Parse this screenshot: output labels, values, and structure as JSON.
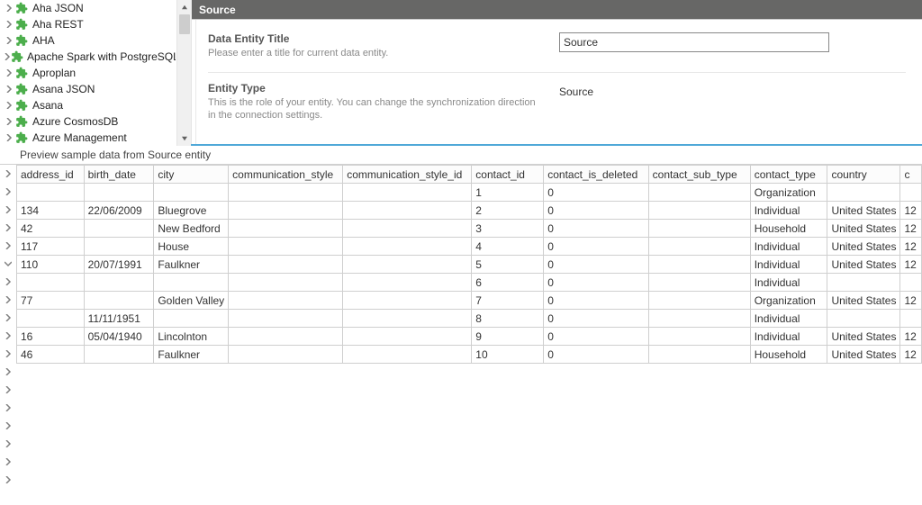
{
  "tree": {
    "items": [
      {
        "label": "Aha JSON"
      },
      {
        "label": "Aha REST"
      },
      {
        "label": "AHA"
      },
      {
        "label": "Apache Spark with PostgreSQL"
      },
      {
        "label": "Aproplan"
      },
      {
        "label": "Asana JSON"
      },
      {
        "label": "Asana"
      },
      {
        "label": "Azure CosmosDB"
      },
      {
        "label": "Azure Management"
      }
    ]
  },
  "right": {
    "header": "Source",
    "title_section": {
      "title": "Data Entity Title",
      "desc": "Please enter a title for current data entity.",
      "value": "Source"
    },
    "type_section": {
      "title": "Entity Type",
      "desc": "This is the role of your entity. You can change the synchronization direction in the connection settings.",
      "value": "Source"
    }
  },
  "preview": {
    "title": "Preview sample data from Source entity",
    "columns": [
      "address_id",
      "birth_date",
      "city",
      "communication_style",
      "communication_style_id",
      "contact_id",
      "contact_is_deleted",
      "contact_sub_type",
      "contact_type",
      "country",
      "c"
    ],
    "rows": [
      {
        "address_id": "",
        "birth_date": "",
        "city": "",
        "communication_style": "",
        "communication_style_id": "",
        "contact_id": "1",
        "contact_is_deleted": "0",
        "contact_sub_type": "",
        "contact_type": "Organization",
        "country": "",
        "c": ""
      },
      {
        "address_id": "134",
        "birth_date": "22/06/2009",
        "city": "Bluegrove",
        "communication_style": "",
        "communication_style_id": "",
        "contact_id": "2",
        "contact_is_deleted": "0",
        "contact_sub_type": "",
        "contact_type": "Individual",
        "country": "United States",
        "c": "12"
      },
      {
        "address_id": "42",
        "birth_date": "",
        "city": "New Bedford",
        "communication_style": "",
        "communication_style_id": "",
        "contact_id": "3",
        "contact_is_deleted": "0",
        "contact_sub_type": "",
        "contact_type": "Household",
        "country": "United States",
        "c": "12"
      },
      {
        "address_id": "117",
        "birth_date": "",
        "city": "House",
        "communication_style": "",
        "communication_style_id": "",
        "contact_id": "4",
        "contact_is_deleted": "0",
        "contact_sub_type": "",
        "contact_type": "Individual",
        "country": "United States",
        "c": "12"
      },
      {
        "address_id": "110",
        "birth_date": "20/07/1991",
        "city": "Faulkner",
        "communication_style": "",
        "communication_style_id": "",
        "contact_id": "5",
        "contact_is_deleted": "0",
        "contact_sub_type": "",
        "contact_type": "Individual",
        "country": "United States",
        "c": "12"
      },
      {
        "address_id": "",
        "birth_date": "",
        "city": "",
        "communication_style": "",
        "communication_style_id": "",
        "contact_id": "6",
        "contact_is_deleted": "0",
        "contact_sub_type": "",
        "contact_type": "Individual",
        "country": "",
        "c": ""
      },
      {
        "address_id": "77",
        "birth_date": "",
        "city": "Golden Valley",
        "communication_style": "",
        "communication_style_id": "",
        "contact_id": "7",
        "contact_is_deleted": "0",
        "contact_sub_type": "",
        "contact_type": "Organization",
        "country": "United States",
        "c": "12"
      },
      {
        "address_id": "",
        "birth_date": "11/11/1951",
        "city": "",
        "communication_style": "",
        "communication_style_id": "",
        "contact_id": "8",
        "contact_is_deleted": "0",
        "contact_sub_type": "",
        "contact_type": "Individual",
        "country": "",
        "c": ""
      },
      {
        "address_id": "16",
        "birth_date": "05/04/1940",
        "city": "Lincolnton",
        "communication_style": "",
        "communication_style_id": "",
        "contact_id": "9",
        "contact_is_deleted": "0",
        "contact_sub_type": "",
        "contact_type": "Individual",
        "country": "United States",
        "c": "12"
      },
      {
        "address_id": "46",
        "birth_date": "",
        "city": "Faulkner",
        "communication_style": "",
        "communication_style_id": "",
        "contact_id": "10",
        "contact_is_deleted": "0",
        "contact_sub_type": "",
        "contact_type": "Household",
        "country": "United States",
        "c": "12"
      }
    ],
    "gutter_states": [
      "closed",
      "closed",
      "closed",
      "closed",
      "closed",
      "open",
      "closed",
      "closed",
      "closed",
      "closed",
      "closed",
      "closed",
      "closed",
      "closed",
      "closed",
      "closed",
      "closed",
      "closed"
    ]
  }
}
